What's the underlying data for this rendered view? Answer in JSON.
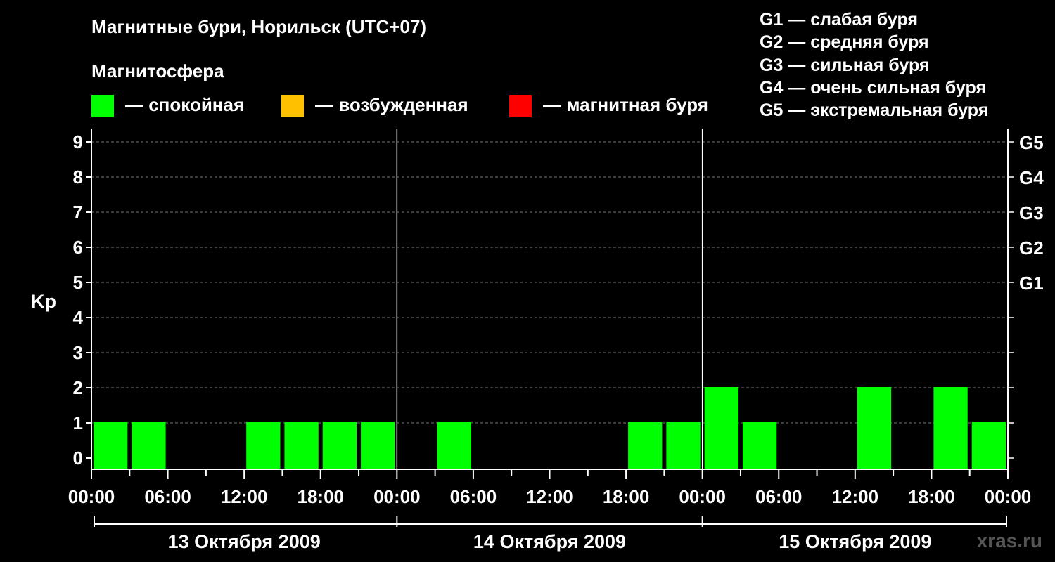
{
  "header": {
    "title": "Магнитные бури, Норильск (UTC+07)",
    "subtitle": "Магнитосфера"
  },
  "legend_states": [
    {
      "label": "— спокойная",
      "color": "#00ff00"
    },
    {
      "label": "— возбужденная",
      "color": "#ffc000"
    },
    {
      "label": "— магнитная буря",
      "color": "#ff0000"
    }
  ],
  "g_scale": [
    "G1 — слабая буря",
    "G2 — средняя буря",
    "G3 — сильная буря",
    "G4 — очень сильная буря",
    "G5 — экстремальная буря"
  ],
  "watermark": "xras.ru",
  "chart_data": {
    "type": "bar",
    "ylabel": "Kp",
    "ylim": [
      0,
      9
    ],
    "yticks": [
      "0",
      "1",
      "2",
      "3",
      "4",
      "5",
      "6",
      "7",
      "8",
      "9"
    ],
    "right_labels": [
      {
        "kp": 5,
        "label": "G1"
      },
      {
        "kp": 6,
        "label": "G2"
      },
      {
        "kp": 7,
        "label": "G3"
      },
      {
        "kp": 8,
        "label": "G4"
      },
      {
        "kp": 9,
        "label": "G5"
      }
    ],
    "xtick_labels": [
      "00:00",
      "06:00",
      "12:00",
      "18:00",
      "00:00",
      "06:00",
      "12:00",
      "18:00",
      "00:00",
      "06:00",
      "12:00",
      "18:00",
      "00:00"
    ],
    "days": [
      "13 Октября 2009",
      "14 Октября 2009",
      "15 Октября 2009"
    ],
    "grid": true,
    "bar_color": "#00ff00",
    "values": [
      [
        1,
        1,
        0,
        0,
        1,
        1,
        1,
        1
      ],
      [
        0,
        1,
        0,
        0,
        0,
        0,
        1,
        1
      ],
      [
        2,
        1,
        0,
        0,
        2,
        0,
        2,
        1
      ]
    ]
  }
}
